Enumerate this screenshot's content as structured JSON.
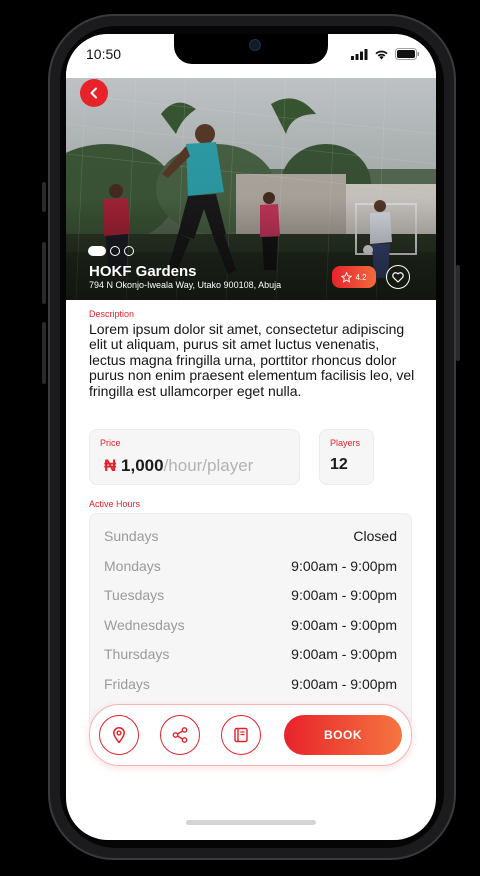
{
  "status": {
    "time": "10:50"
  },
  "venue": {
    "name": "HOKF Gardens",
    "address": "794 N Okonjo-Iweala Way, Utako 900108, Abuja",
    "rating": "4.2",
    "image_count": 3,
    "active_image": 1
  },
  "description": {
    "label": "Description",
    "text": "Lorem ipsum dolor sit amet, consectetur adipiscing elit ut aliquam, purus sit amet luctus venenatis, lectus magna fringilla urna, porttitor rhoncus dolor purus non enim praesent elementum facilisis leo, vel fringilla est ullamcorper eget nulla."
  },
  "price": {
    "label": "Price",
    "currency": "₦",
    "amount": "1,000",
    "unit": "/hour/player"
  },
  "players": {
    "label": "Players",
    "value": "12"
  },
  "hours": {
    "label": "Active Hours",
    "rows": [
      {
        "day": "Sundays",
        "time": "Closed"
      },
      {
        "day": "Mondays",
        "time": "9:00am - 9:00pm"
      },
      {
        "day": "Tuesdays",
        "time": "9:00am - 9:00pm"
      },
      {
        "day": "Wednesdays",
        "time": "9:00am - 9:00pm"
      },
      {
        "day": "Thursdays",
        "time": "9:00am - 9:00pm"
      },
      {
        "day": "Fridays",
        "time": "9:00am - 9:00pm"
      }
    ]
  },
  "actions": {
    "location_icon": "location-pin-icon",
    "share_icon": "share-icon",
    "notes_icon": "notebook-icon",
    "book_label": "BOOK"
  },
  "colors": {
    "accent": "#e8222b",
    "accent_end": "#f5763f"
  }
}
